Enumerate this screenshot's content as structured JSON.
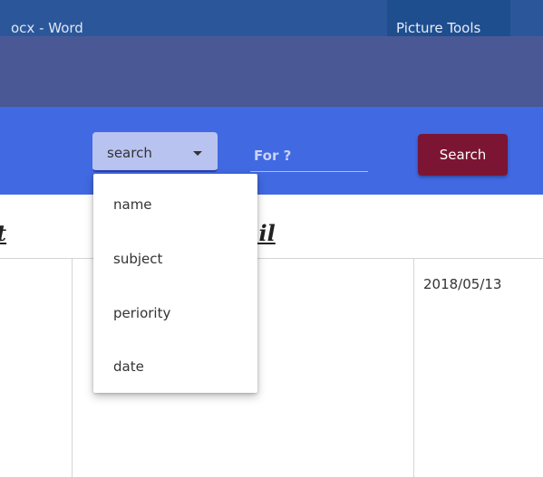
{
  "word_window": {
    "title": "ocx  -  Word",
    "contextual_tab": "Picture Tools"
  },
  "toolbar": {
    "select_value": "search",
    "for_placeholder": "For ?",
    "search_button": "Search"
  },
  "dropdown": {
    "options": [
      "name",
      "subject",
      "periority",
      "date"
    ]
  },
  "table": {
    "headers": {
      "left": "t",
      "mid": "ail"
    },
    "row1": {
      "date": "2018/05/13"
    }
  },
  "colors": {
    "word_blue": "#2b579a",
    "app_band": "#4a5996",
    "toolbar_blue": "#4169e1",
    "select_bg": "#b9c3f0",
    "search_button": "#7b1533"
  }
}
